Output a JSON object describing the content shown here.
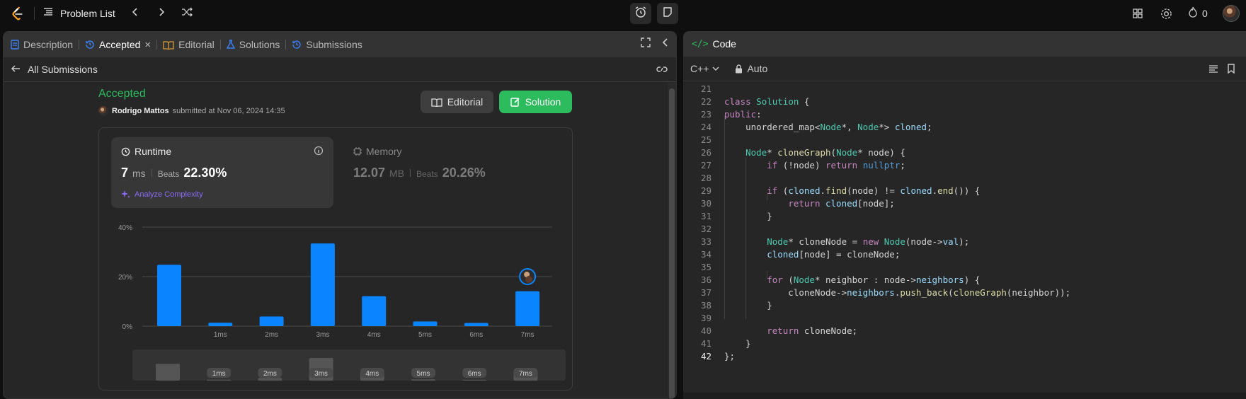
{
  "topbar": {
    "problem_list": "Problem List",
    "streak": "0"
  },
  "tabs": [
    {
      "label": "Description",
      "icon": "description-icon"
    },
    {
      "label": "Accepted",
      "icon": "history-icon"
    },
    {
      "label": "Editorial",
      "icon": "book-icon"
    },
    {
      "label": "Solutions",
      "icon": "flask-icon"
    },
    {
      "label": "Submissions",
      "icon": "history-icon"
    }
  ],
  "subbar": {
    "back_label": "All Submissions"
  },
  "submission": {
    "status": "Accepted",
    "user": "Rodrigo Mattos",
    "submitted_text": "submitted at Nov 06, 2024 14:35",
    "editorial_button": "Editorial",
    "solution_button": "Solution"
  },
  "runtime": {
    "label": "Runtime",
    "value": "7",
    "unit": "ms",
    "beats_label": "Beats",
    "beats": "22.30%",
    "analyze": "Analyze Complexity"
  },
  "memory": {
    "label": "Memory",
    "value": "12.07",
    "unit": "MB",
    "beats_label": "Beats",
    "beats": "20.26%"
  },
  "chart_data": {
    "type": "bar",
    "categories": [
      "",
      "1ms",
      "2ms",
      "3ms",
      "4ms",
      "5ms",
      "6ms",
      "7ms"
    ],
    "values": [
      24.8,
      1.4,
      3.9,
      33.4,
      12.1,
      1.9,
      1.3,
      14.1
    ],
    "ylim": [
      0,
      40
    ],
    "yticks": [
      "40%",
      "20%",
      "0%"
    ],
    "grid": true,
    "highlight_index": 7,
    "mini_labels": [
      "1ms",
      "2ms",
      "3ms",
      "4ms",
      "5ms",
      "6ms",
      "7ms"
    ],
    "colors": {
      "bar": "#0a84ff",
      "mini_bar": "#555555"
    }
  },
  "code": {
    "title": "Code",
    "language": "C++",
    "mode": "Auto",
    "lines": [
      {
        "n": "21",
        "t": ""
      },
      {
        "n": "22",
        "t": "class Solution {"
      },
      {
        "n": "23",
        "t": "public:"
      },
      {
        "n": "24",
        "t": "    unordered_map<Node*, Node*> cloned;"
      },
      {
        "n": "25",
        "t": ""
      },
      {
        "n": "26",
        "t": "    Node* cloneGraph(Node* node) {"
      },
      {
        "n": "27",
        "t": "        if (!node) return nullptr;"
      },
      {
        "n": "28",
        "t": ""
      },
      {
        "n": "29",
        "t": "        if (cloned.find(node) != cloned.end()) {"
      },
      {
        "n": "30",
        "t": "            return cloned[node];"
      },
      {
        "n": "31",
        "t": "        }"
      },
      {
        "n": "32",
        "t": ""
      },
      {
        "n": "33",
        "t": "        Node* cloneNode = new Node(node->val);"
      },
      {
        "n": "34",
        "t": "        cloned[node] = cloneNode;"
      },
      {
        "n": "35",
        "t": ""
      },
      {
        "n": "36",
        "t": "        for (Node* neighbor : node->neighbors) {"
      },
      {
        "n": "37",
        "t": "            cloneNode->neighbors.push_back(cloneGraph(neighbor));"
      },
      {
        "n": "38",
        "t": "        }"
      },
      {
        "n": "39",
        "t": ""
      },
      {
        "n": "40",
        "t": "        return cloneNode;"
      },
      {
        "n": "41",
        "t": "    }"
      },
      {
        "n": "42",
        "t": "};"
      }
    ]
  }
}
